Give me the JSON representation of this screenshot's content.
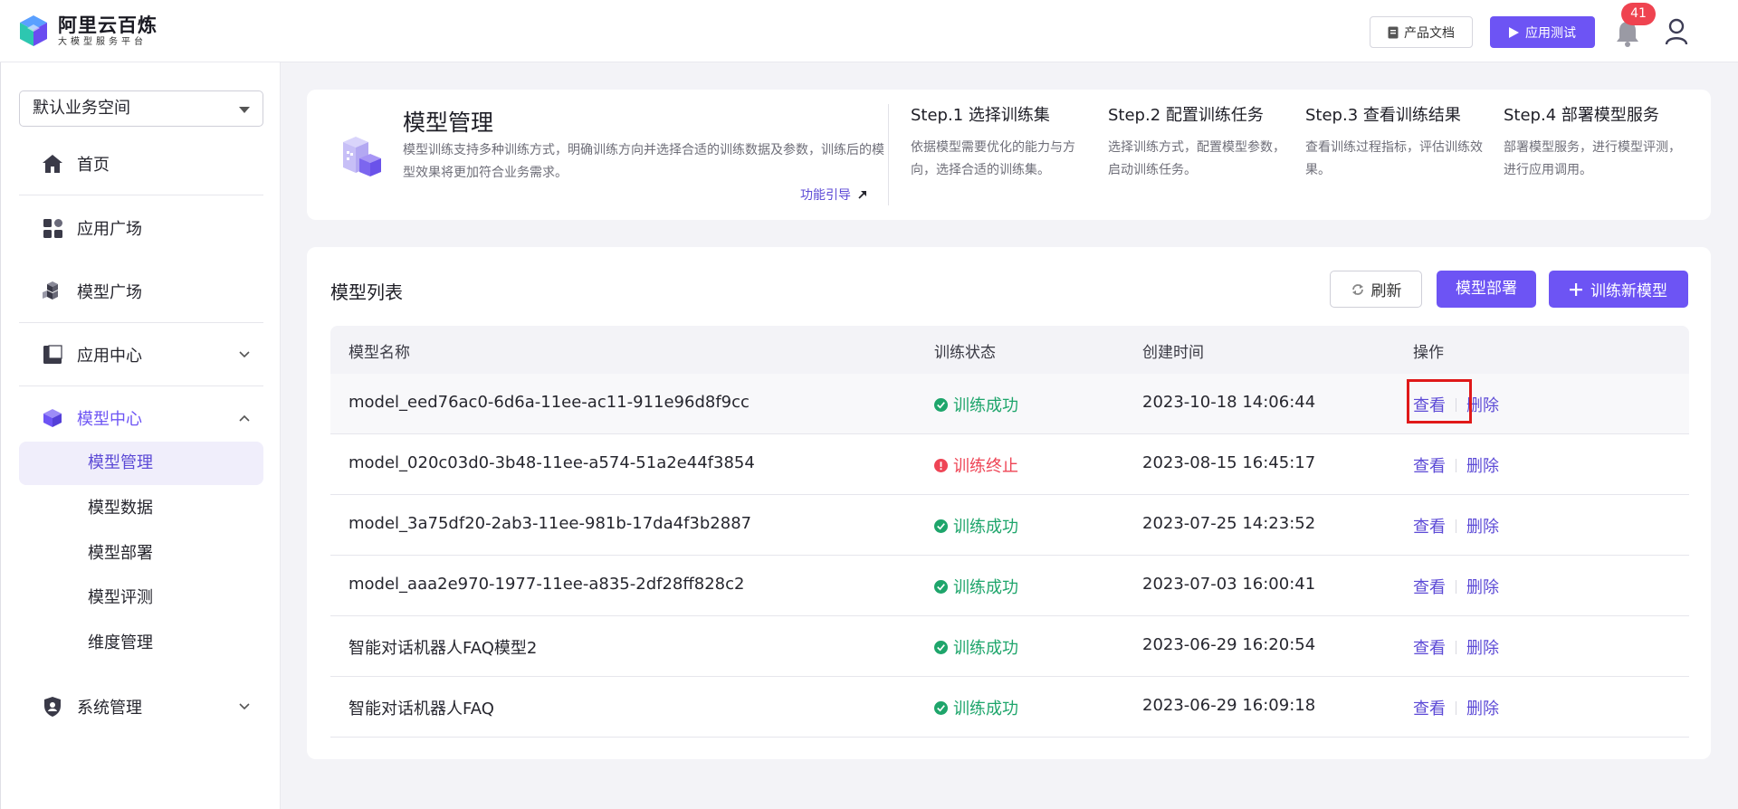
{
  "header": {
    "brand_title": "阿里云百炼",
    "brand_subtitle": "大模型服务平台",
    "doc_label": "产品文档",
    "test_label": "应用测试",
    "notification_count": "41"
  },
  "sidebar": {
    "workspace": "默认业务空间",
    "items": [
      {
        "label": "首页",
        "icon": "home-icon"
      },
      {
        "label": "应用广场",
        "icon": "app-grid-icon"
      },
      {
        "label": "模型广场",
        "icon": "cubes-icon"
      },
      {
        "label": "应用中心",
        "icon": "app-center-icon"
      },
      {
        "label": "模型中心",
        "icon": "model-cube-icon"
      },
      {
        "label": "系统管理",
        "icon": "shield-icon"
      }
    ],
    "model_sub": [
      "模型管理",
      "模型数据",
      "模型部署",
      "模型评测",
      "维度管理"
    ]
  },
  "intro": {
    "title": "模型管理",
    "desc": "模型训练支持多种训练方式，明确训练方向并选择合适的训练数据及参数，训练后的模型效果将更加符合业务需求。",
    "guide_link": "功能引导",
    "steps": [
      {
        "title": "Step.1 选择训练集",
        "desc": "依据模型需要优化的能力与方向，选择合适的训练集。"
      },
      {
        "title": "Step.2 配置训练任务",
        "desc": "选择训练方式，配置模型参数，启动训练任务。"
      },
      {
        "title": "Step.3 查看训练结果",
        "desc": "查看训练过程指标，评估训练效果。"
      },
      {
        "title": "Step.4 部署模型服务",
        "desc": "部署模型服务，进行模型评测，进行应用调用。"
      }
    ]
  },
  "list": {
    "title": "模型列表",
    "refresh_label": "刷新",
    "deploy_label": "模型部署",
    "train_label": "训练新模型",
    "columns": [
      "模型名称",
      "训练状态",
      "创建时间",
      "操作"
    ],
    "view_label": "查看",
    "delete_label": "删除",
    "rows": [
      {
        "name": "model_eed76ac0-6d6a-11ee-ac11-911e96d8f9cc",
        "status": "训练成功",
        "state": "ok",
        "time": "2023-10-18 14:06:44"
      },
      {
        "name": "model_020c03d0-3b48-11ee-a574-51a2e44f3854",
        "status": "训练终止",
        "state": "err",
        "time": "2023-08-15 16:45:17"
      },
      {
        "name": "model_3a75df20-2ab3-11ee-981b-17da4f3b2887",
        "status": "训练成功",
        "state": "ok",
        "time": "2023-07-25 14:23:52"
      },
      {
        "name": "model_aaa2e970-1977-11ee-a835-2df28ff828c2",
        "status": "训练成功",
        "state": "ok",
        "time": "2023-07-03 16:00:41"
      },
      {
        "name": "智能对话机器人FAQ模型2",
        "status": "训练成功",
        "state": "ok",
        "time": "2023-06-29 16:20:54"
      },
      {
        "name": "智能对话机器人FAQ",
        "status": "训练成功",
        "state": "ok",
        "time": "2023-06-29 16:09:18"
      }
    ]
  },
  "colors": {
    "accent": "#6d54f4",
    "success": "#1ea56b",
    "error": "#ee4455",
    "highlight_box": "#e01919"
  }
}
